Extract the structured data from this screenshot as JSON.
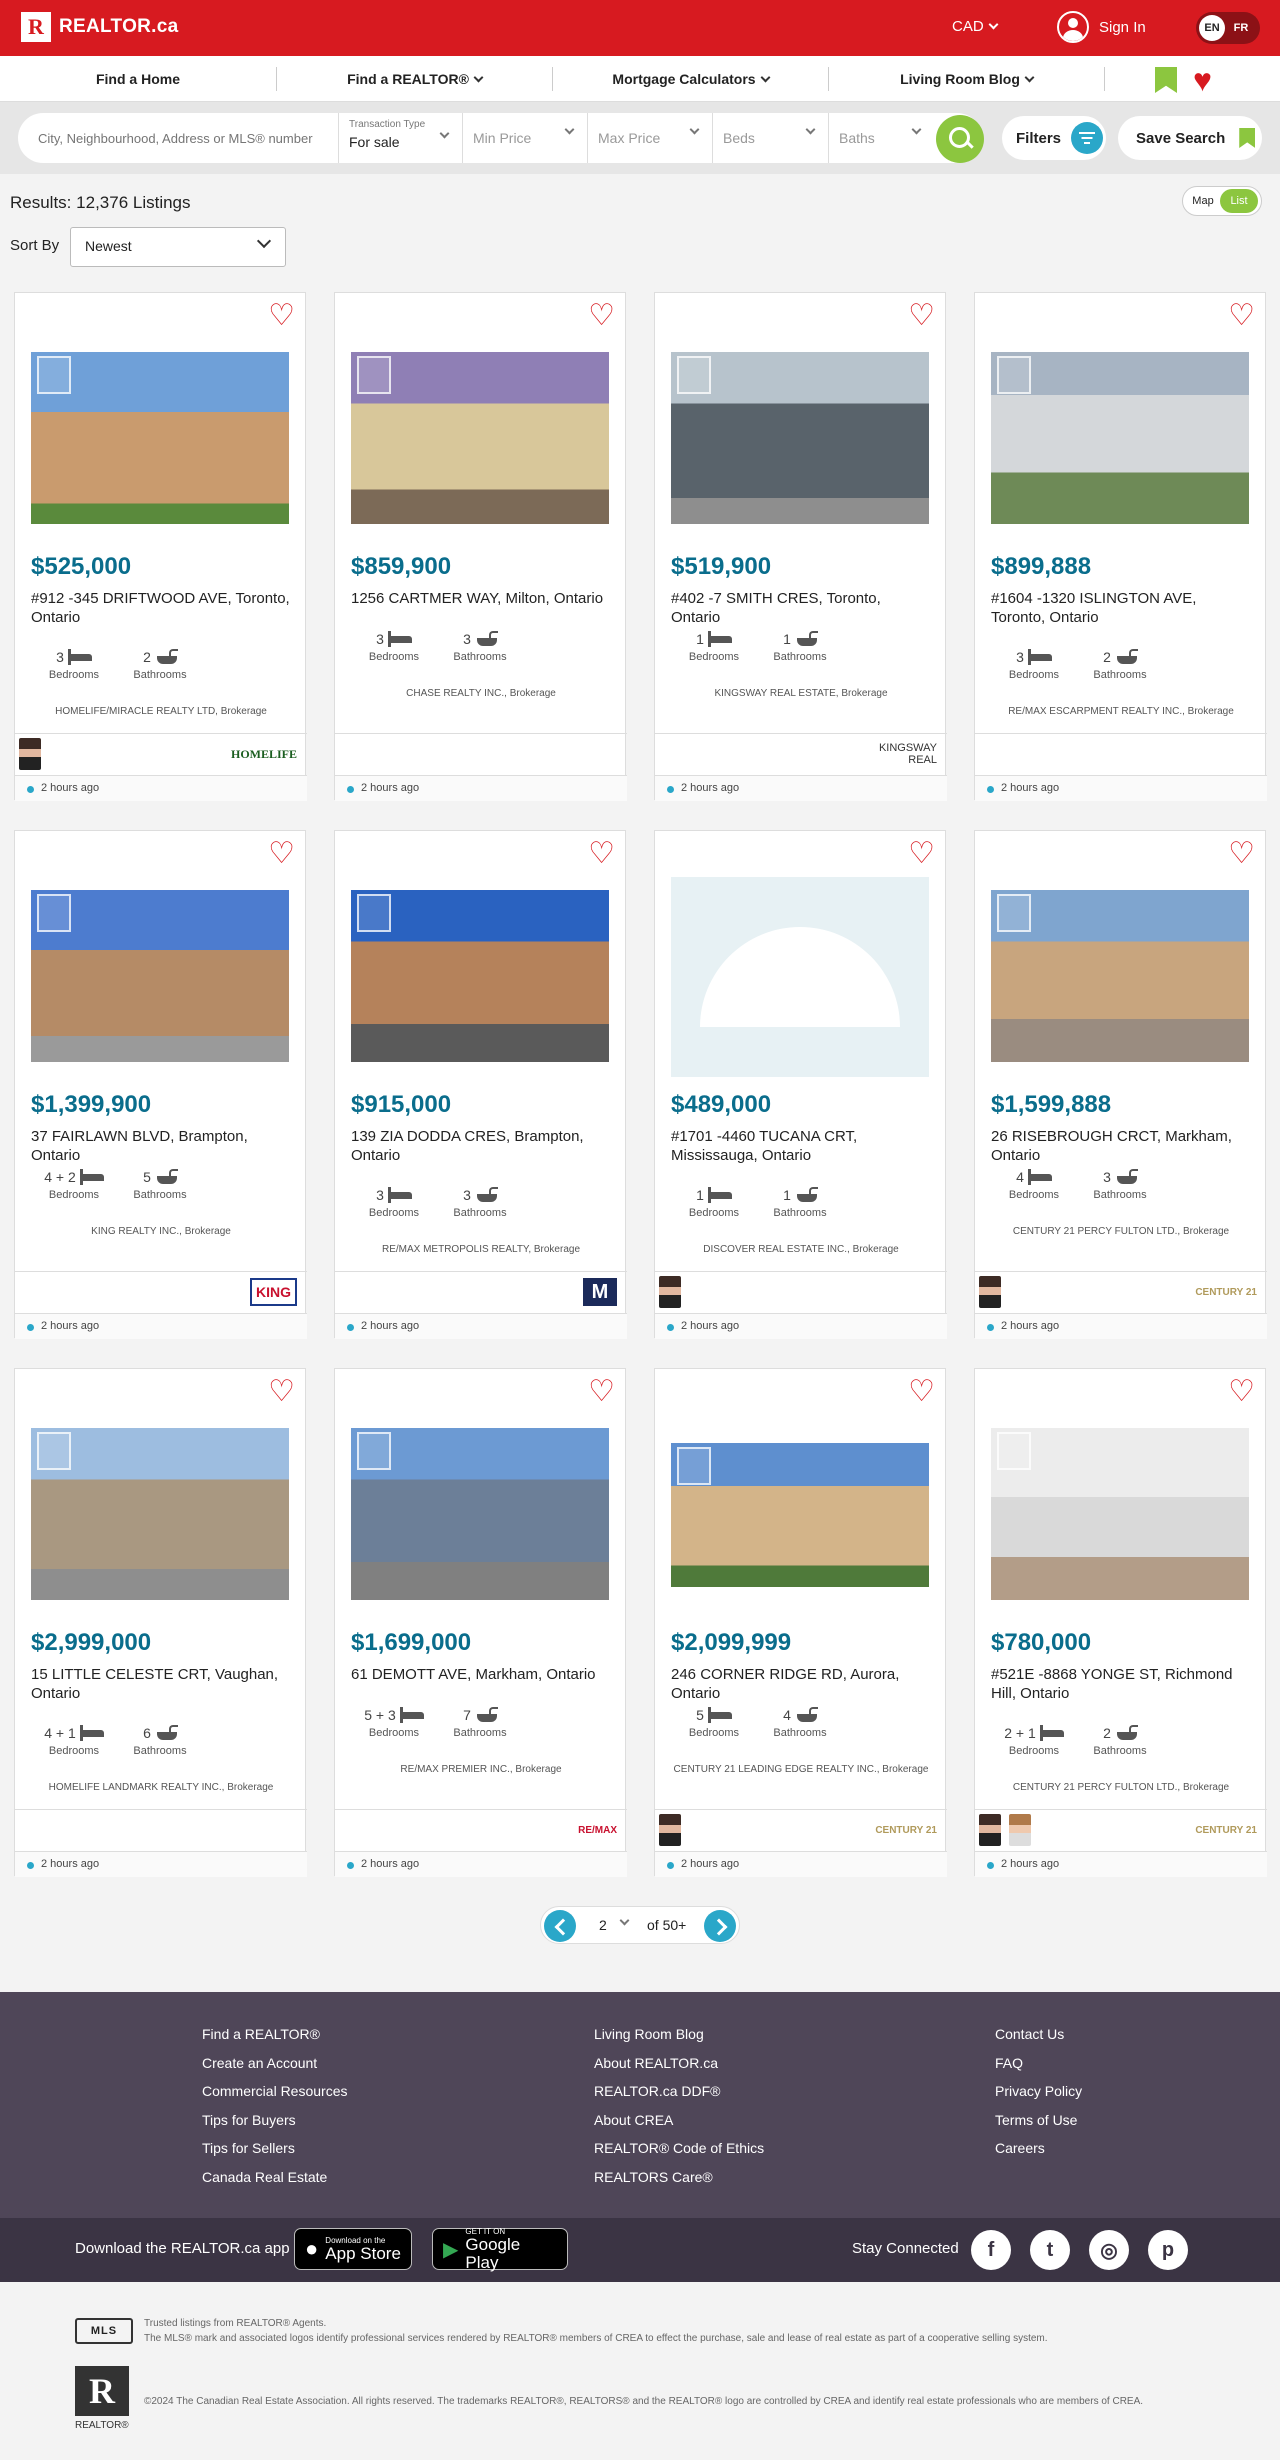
{
  "header": {
    "brand": "REALTOR.ca",
    "currency": "CAD",
    "sign_in": "Sign In",
    "lang_en": "EN",
    "lang_fr": "FR"
  },
  "nav": {
    "find_home": "Find a Home",
    "find_realtor": "Find a REALTOR®",
    "mortgage": "Mortgage Calculators",
    "blog": "Living Room Blog"
  },
  "search": {
    "placeholder": "City, Neighbourhood, Address or MLS® number",
    "transaction_label": "Transaction Type",
    "transaction_value": "For sale",
    "min_price": "Min Price",
    "max_price": "Max Price",
    "beds": "Beds",
    "baths": "Baths",
    "filters": "Filters",
    "save_search": "Save Search"
  },
  "results": {
    "label": "Results:",
    "count": "12,376 Listings",
    "sort_label": "Sort By",
    "sort_value": "Newest",
    "view_map": "Map",
    "view_list": "List"
  },
  "labels": {
    "bedrooms": "Bedrooms",
    "bathrooms": "Bathrooms"
  },
  "listings": [
    {
      "price": "$525,000",
      "address": "#912 -345 DRIFTWOOD AVE, Toronto, Ontario",
      "beds": "3",
      "baths": "2",
      "brokerage": "HOMELIFE/MIRACLE REALTY LTD, Brokerage",
      "time": "2 hours ago",
      "logo": "HOMELIFE"
    },
    {
      "price": "$859,900",
      "address": "1256 CARTMER WAY, Milton, Ontario",
      "beds": "3",
      "baths": "3",
      "brokerage": "CHASE REALTY INC., Brokerage",
      "time": "2 hours ago",
      "logo": ""
    },
    {
      "price": "$519,900",
      "address": "#402 -7 SMITH CRES, Toronto, Ontario",
      "beds": "1",
      "baths": "1",
      "brokerage": "KINGSWAY REAL ESTATE, Brokerage",
      "time": "2 hours ago",
      "logo": "KINGSWAY REAL"
    },
    {
      "price": "$899,888",
      "address": "#1604 -1320 ISLINGTON AVE, Toronto, Ontario",
      "beds": "3",
      "baths": "2",
      "brokerage": "RE/MAX ESCARPMENT REALTY INC., Brokerage",
      "time": "2 hours ago",
      "logo": ""
    },
    {
      "price": "$1,399,900",
      "address": "37 FAIRLAWN BLVD, Brampton, Ontario",
      "beds": "4 + 2",
      "baths": "5",
      "brokerage": "KING REALTY INC., Brokerage",
      "time": "2 hours ago",
      "logo": "KING"
    },
    {
      "price": "$915,000",
      "address": "139 ZIA DODDA CRES, Brampton, Ontario",
      "beds": "3",
      "baths": "3",
      "brokerage": "RE/MAX METROPOLIS REALTY, Brokerage",
      "time": "2 hours ago",
      "logo": "M"
    },
    {
      "price": "$489,000",
      "address": "#1701 -4460 TUCANA CRT, Mississauga, Ontario",
      "beds": "1",
      "baths": "1",
      "brokerage": "DISCOVER REAL ESTATE INC., Brokerage",
      "time": "2 hours ago",
      "logo": ""
    },
    {
      "price": "$1,599,888",
      "address": "26 RISEBROUGH CRCT, Markham, Ontario",
      "beds": "4",
      "baths": "3",
      "brokerage": "CENTURY 21 PERCY FULTON LTD., Brokerage",
      "time": "2 hours ago",
      "logo": "CENTURY 21"
    },
    {
      "price": "$2,999,000",
      "address": "15 LITTLE CELESTE CRT, Vaughan, Ontario",
      "beds": "4 + 1",
      "baths": "6",
      "brokerage": "HOMELIFE LANDMARK REALTY INC., Brokerage",
      "time": "2 hours ago",
      "logo": ""
    },
    {
      "price": "$1,699,000",
      "address": "61 DEMOTT AVE, Markham, Ontario",
      "beds": "5 + 3",
      "baths": "7",
      "brokerage": "RE/MAX PREMIER INC., Brokerage",
      "time": "2 hours ago",
      "logo": "RE/MAX"
    },
    {
      "price": "$2,099,999",
      "address": "246 CORNER RIDGE RD, Aurora, Ontario",
      "beds": "5",
      "baths": "4",
      "brokerage": "CENTURY 21 LEADING EDGE REALTY INC., Brokerage",
      "time": "2 hours ago",
      "logo": "CENTURY 21"
    },
    {
      "price": "$780,000",
      "address": "#521E -8868 YONGE ST, Richmond Hill, Ontario",
      "beds": "2 + 1",
      "baths": "2",
      "brokerage": "CENTURY 21 PERCY FULTON LTD., Brokerage",
      "time": "2 hours ago",
      "logo": "CENTURY 21"
    }
  ],
  "pagination": {
    "current": "2",
    "of": "of 50+"
  },
  "footer": {
    "col1": [
      "Find a REALTOR®",
      "Create an Account",
      "Commercial Resources",
      "Tips for Buyers",
      "Tips for Sellers",
      "Canada Real Estate"
    ],
    "col2": [
      "Living Room Blog",
      "About REALTOR.ca",
      "REALTOR.ca DDF®",
      "About CREA",
      "REALTOR® Code of Ethics",
      "REALTORS Care®"
    ],
    "col3": [
      "Contact Us",
      "FAQ",
      "Privacy Policy",
      "Terms of Use",
      "Careers"
    ],
    "download": "Download the REALTOR.ca app",
    "appstore_small": "Download on the",
    "appstore_big": "App Store",
    "google_small": "GET IT ON",
    "google_big": "Google Play",
    "stay": "Stay Connected",
    "mls": "MLS",
    "legal1": "Trusted listings from REALTOR® Agents.",
    "legal2": "The MLS® mark and associated logos identify professional services rendered by REALTOR® members of CREA to effect the purchase, sale and lease of real estate as part of a cooperative selling system.",
    "legal3": "©2024 The Canadian Real Estate Association. All rights reserved. The trademarks REALTOR®, REALTORS® and the REALTOR® logo are controlled by CREA and identify real estate professionals who are members of CREA.",
    "realtor_word": "REALTOR®"
  },
  "colors": {
    "brand_red": "#d71a20",
    "price_teal": "#0a6d8c",
    "accent_green": "#8cc63f",
    "accent_blue": "#2aa7c9"
  }
}
